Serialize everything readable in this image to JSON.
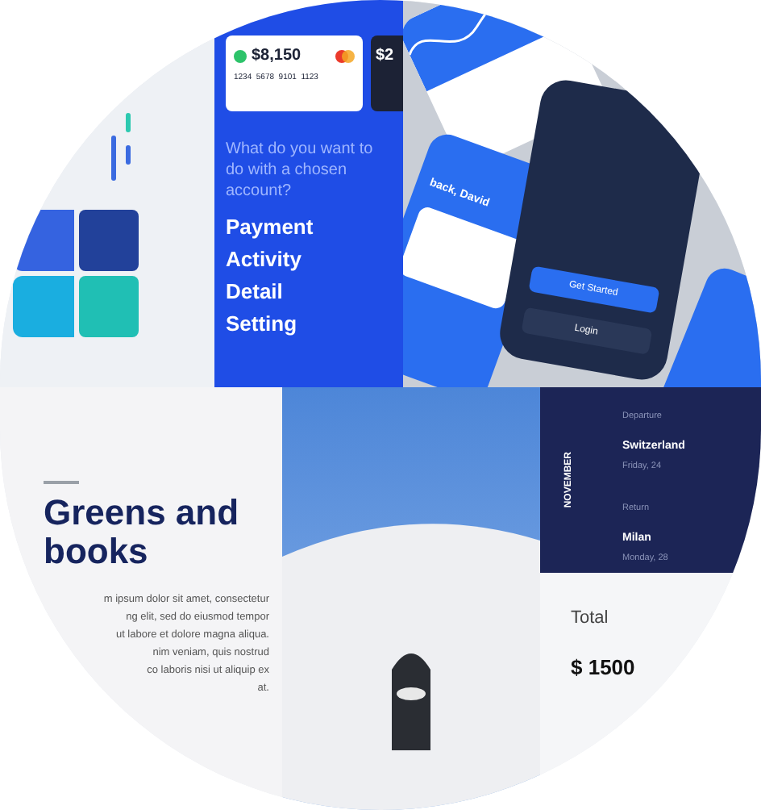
{
  "account_panel": {
    "cards": [
      {
        "balance": "$8,150",
        "number": "1234  5678  9101  1123"
      },
      {
        "balance": "$2"
      }
    ],
    "question": "What do you want to do with a chosen account?",
    "menu": [
      {
        "label": "Payment"
      },
      {
        "label": "Activity"
      },
      {
        "label": "Detail"
      },
      {
        "label": "Setting"
      }
    ]
  },
  "phones": {
    "greeting": "back, David",
    "primary_button": "Get Started",
    "secondary_button": "Login"
  },
  "article": {
    "title_lines": [
      "Greens and",
      "books"
    ],
    "body_lines": [
      "m ipsum dolor sit amet, consectetur",
      "ng elit, sed do eiusmod tempor",
      "ut labore et dolore magna aliqua.",
      "nim veniam, quis nostrud",
      "co laboris nisi ut aliquip ex",
      "at."
    ]
  },
  "ticket": {
    "month": "NOVEMBER",
    "legs": [
      {
        "label": "Departure",
        "city": "Switzerland",
        "date": "Friday, 24"
      },
      {
        "label": "Return",
        "city": "Milan",
        "date": "Monday, 28"
      }
    ],
    "total_label": "Total",
    "total": "$ 1500"
  }
}
